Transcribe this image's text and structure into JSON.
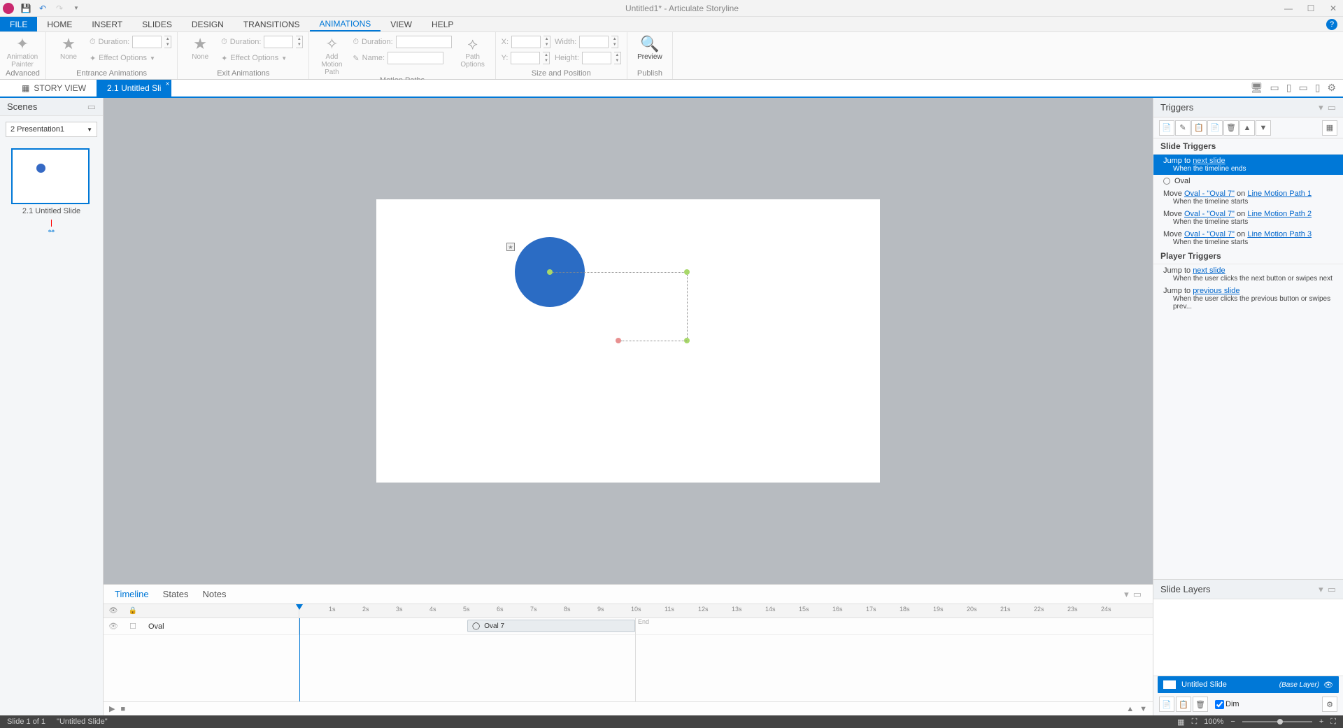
{
  "titlebar": {
    "title": "Untitled1* - Articulate Storyline"
  },
  "menubar": {
    "file": "FILE",
    "home": "HOME",
    "insert": "INSERT",
    "slides": "SLIDES",
    "design": "DESIGN",
    "transitions": "TRANSITIONS",
    "animations": "ANIMATIONS",
    "view": "VIEW",
    "help": "HELP"
  },
  "ribbon": {
    "animation_painter": "Animation Painter",
    "advanced": "Advanced",
    "none": "None",
    "duration_label": "Duration:",
    "effect_options": "Effect Options",
    "entrance_group": "Entrance Animations",
    "exit_group": "Exit Animations",
    "add_motion_path": "Add Motion Path",
    "name_label": "Name:",
    "path_options": "Path Options",
    "motion_paths_group": "Motion Paths",
    "x_label": "X:",
    "y_label": "Y:",
    "width_label": "Width:",
    "height_label": "Height:",
    "size_position_group": "Size and Position",
    "preview": "Preview",
    "publish_group": "Publish"
  },
  "doc_tabs": {
    "story_view": "STORY VIEW",
    "active_tab": "2.1 Untitled Sli"
  },
  "scenes": {
    "title": "Scenes",
    "selector": "2 Presentation1",
    "slide_caption": "2.1 Untitled Slide"
  },
  "triggers": {
    "title": "Triggers",
    "slide_triggers_header": "Slide Triggers",
    "jump_to": "Jump to ",
    "next_slide": "next slide",
    "when_timeline_ends": "When the timeline ends",
    "oval_object": "Oval",
    "move": "Move ",
    "oval_link": "Oval - \"Oval 7\"",
    "on": " on ",
    "path1": "Line Motion Path 1",
    "path2": "Line Motion Path 2",
    "path3": "Line Motion Path 3",
    "when_timeline_starts": "When the timeline starts",
    "player_triggers_header": "Player Triggers",
    "previous_slide": "previous slide",
    "when_next": "When the user clicks the next button or swipes next",
    "when_prev": "When the user clicks the previous button or swipes prev..."
  },
  "layers": {
    "title": "Slide Layers",
    "untitled_slide": "Untitled Slide",
    "base_layer": "(Base Layer)",
    "dim": "Dim"
  },
  "timeline": {
    "tab_timeline": "Timeline",
    "tab_states": "States",
    "tab_notes": "Notes",
    "row_oval": "Oval",
    "clip_label": "Oval 7",
    "end_label": "End",
    "ticks": [
      "1s",
      "2s",
      "3s",
      "4s",
      "5s",
      "6s",
      "7s",
      "8s",
      "9s",
      "10s",
      "11s",
      "12s",
      "13s",
      "14s",
      "15s",
      "16s",
      "17s",
      "18s",
      "19s",
      "20s",
      "21s",
      "22s",
      "23s",
      "24s"
    ]
  },
  "statusbar": {
    "slide_count": "Slide 1 of 1",
    "slide_name": "\"Untitled Slide\"",
    "zoom": "100%"
  }
}
